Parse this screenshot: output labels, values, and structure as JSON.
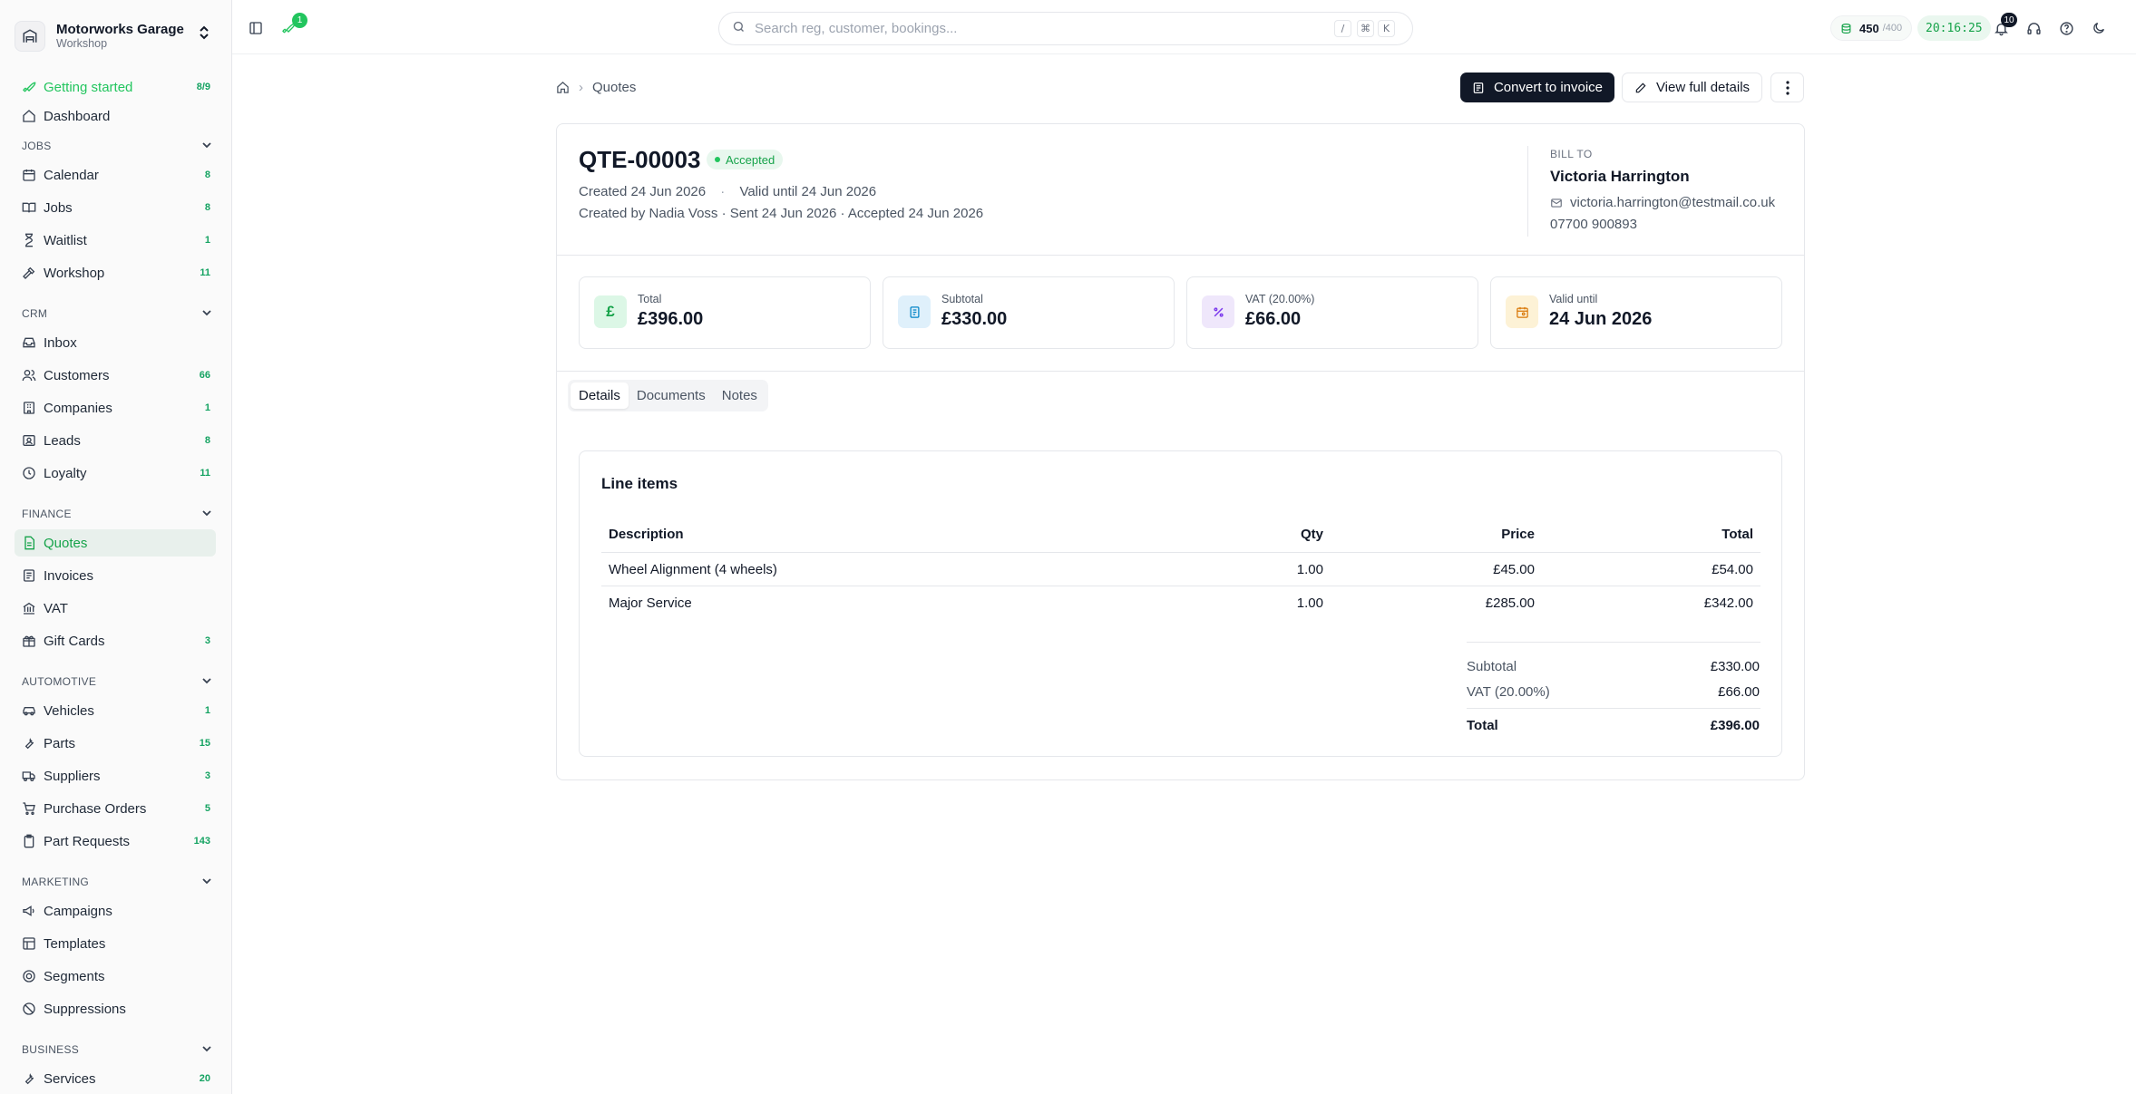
{
  "brand": {
    "name": "Motorworks Garage",
    "sub": "Workshop"
  },
  "nav": {
    "getting_started": {
      "label": "Getting started",
      "badge": "8/9"
    },
    "dashboard": {
      "label": "Dashboard"
    },
    "jobs_head": "JOBS",
    "calendar": {
      "label": "Calendar",
      "badge": "8"
    },
    "jobs": {
      "label": "Jobs",
      "badge": "8"
    },
    "waitlist": {
      "label": "Waitlist",
      "badge": "1"
    },
    "workshop": {
      "label": "Workshop",
      "badge": "11"
    },
    "crm_head": "CRM",
    "inbox": {
      "label": "Inbox"
    },
    "customers": {
      "label": "Customers",
      "badge": "66"
    },
    "companies": {
      "label": "Companies",
      "badge": "1"
    },
    "leads": {
      "label": "Leads",
      "badge": "8"
    },
    "loyalty": {
      "label": "Loyalty",
      "badge": "11"
    },
    "finance_head": "FINANCE",
    "quotes": {
      "label": "Quotes"
    },
    "invoices": {
      "label": "Invoices"
    },
    "vat": {
      "label": "VAT"
    },
    "gift_cards": {
      "label": "Gift Cards",
      "badge": "3"
    },
    "automotive_head": "AUTOMOTIVE",
    "vehicles": {
      "label": "Vehicles",
      "badge": "1"
    },
    "parts": {
      "label": "Parts",
      "badge": "15"
    },
    "suppliers": {
      "label": "Suppliers",
      "badge": "3"
    },
    "purchase_orders": {
      "label": "Purchase Orders",
      "badge": "5"
    },
    "part_requests": {
      "label": "Part Requests",
      "badge": "143"
    },
    "marketing_head": "MARKETING",
    "campaigns": {
      "label": "Campaigns"
    },
    "templates": {
      "label": "Templates"
    },
    "segments": {
      "label": "Segments"
    },
    "suppressions": {
      "label": "Suppressions"
    },
    "business_head": "BUSINESS",
    "services": {
      "label": "Services",
      "badge": "20"
    }
  },
  "topbar": {
    "rocket_badge": "1",
    "search_placeholder": "Search reg, customer, bookings...",
    "kbd1": "/",
    "kbd2": "⌘",
    "kbd3": "K",
    "credits_value": "450",
    "credits_max": "/400",
    "clock": "20:16:25",
    "notif_count": "10"
  },
  "breadcrumb": {
    "current": "Quotes"
  },
  "actions": {
    "convert": "Convert to invoice",
    "view_full": "View full details"
  },
  "quote": {
    "number": "QTE-00003",
    "status": "Accepted",
    "created": "Created 24 Jun 2026",
    "valid": "Valid until 24 Jun 2026",
    "meta2": "Created by Nadia Voss · Sent 24 Jun 2026 · Accepted 24 Jun 2026"
  },
  "bill_to": {
    "label": "BILL TO",
    "name": "Victoria Harrington",
    "email": "victoria.harrington@testmail.co.uk",
    "phone": "07700 900893"
  },
  "stats": [
    {
      "label": "Total",
      "value": "£396.00",
      "icon": "pound-icon"
    },
    {
      "label": "Subtotal",
      "value": "£330.00",
      "icon": "receipt-icon"
    },
    {
      "label": "VAT (20.00%)",
      "value": "£66.00",
      "icon": "percent-icon"
    },
    {
      "label": "Valid until",
      "value": "24 Jun 2026",
      "icon": "calendar-icon"
    }
  ],
  "tabs": [
    "Details",
    "Documents",
    "Notes"
  ],
  "line_items": {
    "title": "Line items",
    "headers": [
      "Description",
      "Qty",
      "Price",
      "Total"
    ],
    "rows": [
      {
        "description": "Wheel Alignment (4 wheels)",
        "qty": "1.00",
        "price": "£45.00",
        "total": "£54.00"
      },
      {
        "description": "Major Service",
        "qty": "1.00",
        "price": "£285.00",
        "total": "£342.00"
      }
    ],
    "subtotal_label": "Subtotal",
    "subtotal": "£330.00",
    "vat_label": "VAT (20.00%)",
    "vat": "£66.00",
    "total_label": "Total",
    "total": "£396.00"
  },
  "colors": {
    "accent": "#22c55e",
    "dark_button": "#111827",
    "active_nav_bg": "#e8f0ec"
  }
}
